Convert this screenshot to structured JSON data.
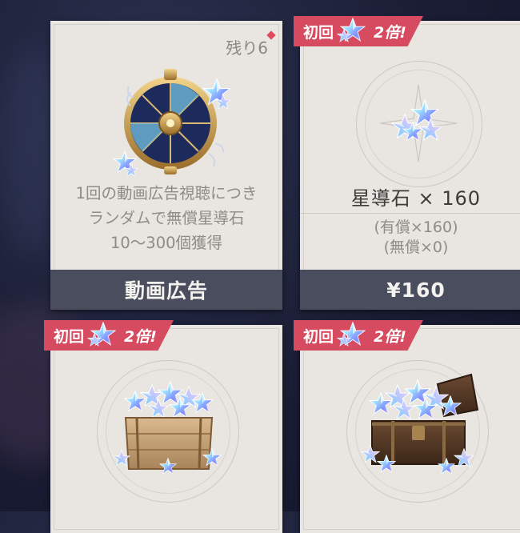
{
  "cards": [
    {
      "remaining": "残り6",
      "description": [
        "1回の動画広告視聴につき",
        "ランダムで無償星導石",
        "10〜300個獲得"
      ],
      "button": "動画広告"
    },
    {
      "badge": {
        "first": "初回",
        "multiplier": "2倍!"
      },
      "name": "星導石 × 160",
      "paid": "(有償×160)",
      "free": "(無償×0)",
      "price": "¥160"
    },
    {
      "badge": {
        "first": "初回",
        "multiplier": "2倍!"
      }
    },
    {
      "badge": {
        "first": "初回",
        "multiplier": "2倍!"
      }
    }
  ],
  "colors": {
    "badge": "#d64b5f",
    "footer": "#4a4d5e",
    "card": "#e9e6e1"
  }
}
